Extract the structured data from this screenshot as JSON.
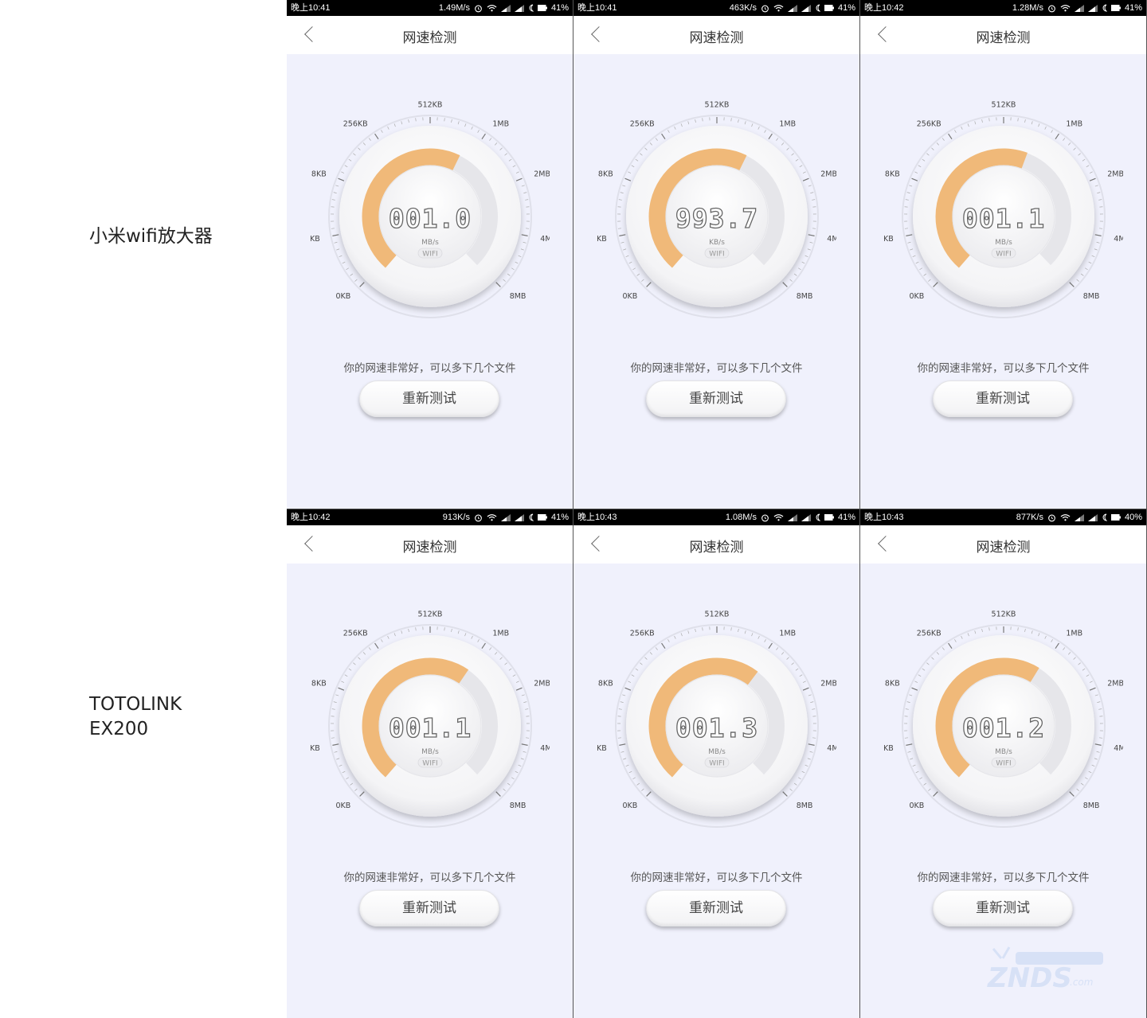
{
  "rows": [
    {
      "label": "小米wifi放大器"
    },
    {
      "label": "TOTOLINK\nEX200"
    }
  ],
  "scale_labels": [
    "0KB",
    "64KB",
    "128KB",
    "256KB",
    "512KB",
    "1MB",
    "2MB",
    "4MB",
    "8MB"
  ],
  "screens": [
    {
      "time": "晚上10:41",
      "net_speed": "1.49M/s",
      "battery": "41%",
      "title": "网速检测",
      "reading": "001.0",
      "unit": "MB/s",
      "conn": "WIFI",
      "progress": 0.6,
      "message": "你的网速非常好，可以多下几个文件",
      "button": "重新测试"
    },
    {
      "time": "晚上10:41",
      "net_speed": "463K/s",
      "battery": "41%",
      "title": "网速检测",
      "reading": "993.7",
      "unit": "KB/s",
      "conn": "WIFI",
      "progress": 0.6,
      "message": "你的网速非常好，可以多下几个文件",
      "button": "重新测试"
    },
    {
      "time": "晚上10:42",
      "net_speed": "1.28M/s",
      "battery": "41%",
      "title": "网速检测",
      "reading": "001.1",
      "unit": "MB/s",
      "conn": "WIFI",
      "progress": 0.58,
      "message": "你的网速非常好，可以多下几个文件",
      "button": "重新测试"
    },
    {
      "time": "晚上10:42",
      "net_speed": "913K/s",
      "battery": "41%",
      "title": "网速检测",
      "reading": "001.1",
      "unit": "MB/s",
      "conn": "WIFI",
      "progress": 0.63,
      "message": "你的网速非常好，可以多下几个文件",
      "button": "重新测试"
    },
    {
      "time": "晚上10:43",
      "net_speed": "1.08M/s",
      "battery": "41%",
      "title": "网速检测",
      "reading": "001.3",
      "unit": "MB/s",
      "conn": "WIFI",
      "progress": 0.64,
      "message": "你的网速非常好，可以多下几个文件",
      "button": "重新测试"
    },
    {
      "time": "晚上10:43",
      "net_speed": "877K/s",
      "battery": "40%",
      "title": "网速检测",
      "reading": "001.2",
      "unit": "MB/s",
      "conn": "WIFI",
      "progress": 0.62,
      "message": "你的网速非常好，可以多下几个文件",
      "button": "重新测试"
    }
  ],
  "icons": {
    "back": "chevron-left-icon",
    "alarm": "alarm-icon",
    "wifi": "wifi-icon",
    "signal": "signal-icon",
    "battery": "battery-icon"
  },
  "colors": {
    "arc_active": "#f0b979",
    "arc_track": "#e6e6ea",
    "screen_bg": "#f0f1fc",
    "digits": "#666666"
  }
}
